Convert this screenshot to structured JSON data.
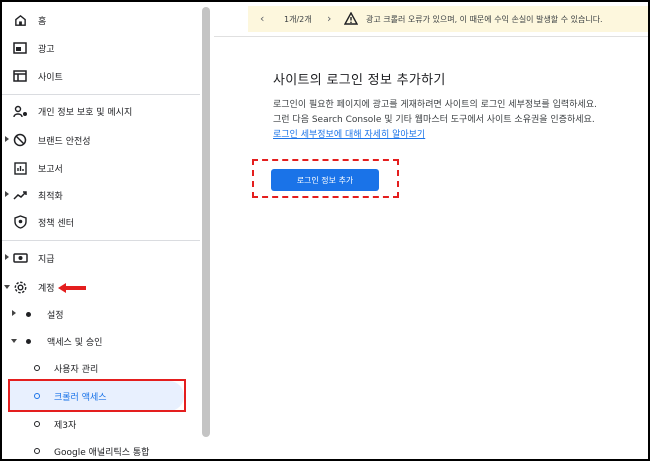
{
  "sidebar": {
    "home": "홈",
    "ads": "광고",
    "sites": "사이트",
    "privacy": "개인 정보 보호 및 메시지",
    "brand_safety": "브랜드 안전성",
    "reports": "보고서",
    "optimization": "최적화",
    "policy_center": "정책 센터",
    "payments": "지급",
    "account": "계정",
    "settings": "설정",
    "access": "액세스 및 승인",
    "user_management": "사용자 관리",
    "crawler_access": "크롤러 액세스",
    "third_party": "제3자",
    "google_analytics": "Google 애널리틱스 통합"
  },
  "banner": {
    "pages": "1개/2개",
    "message": "광고 크롤러 오류가 있으며, 이 때문에 수익 손실이 발생할 수 있습니다."
  },
  "main": {
    "title": "사이트의 로그인 정보 추가하기",
    "description": "로그인이 필요한 페이지에 광고를 게재하려면 사이트의 로그인 세부정보를 입력하세요. 그런 다음 Search Console 및 기타 웹마스터 도구에서 사이트 소유권을 인증하세요.",
    "link": "로그인 세부정보에 대해 자세히 알아보기",
    "button": "로그인 정보 추가"
  },
  "colors": {
    "accent": "#1a73e8",
    "annotation": "#e41e1e",
    "banner_bg": "#fdf7dd",
    "selected_bg": "#e8f0fe"
  }
}
